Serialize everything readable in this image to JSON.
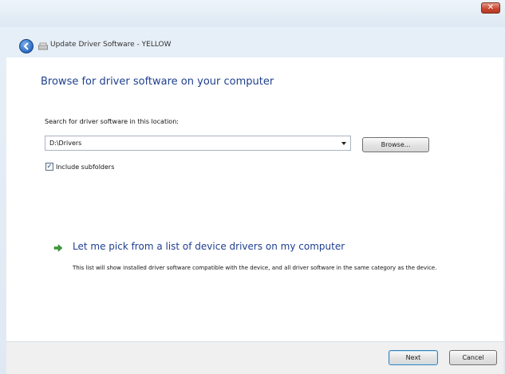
{
  "window": {
    "title": "Update Driver Software - YELLOW",
    "close_glyph": "✕"
  },
  "content": {
    "heading": "Browse for driver software on your computer",
    "search_label": "Search for driver software in this location:",
    "path_value": "D:\\Drivers",
    "browse_label": "Browse...",
    "include_subfolders_label": "Include subfolders",
    "include_subfolders_checked": true,
    "pick_link_title": "Let me pick from a list of device drivers on my computer",
    "pick_link_desc": "This list will show installed driver software compatible with the device, and all driver software in the same category as the device."
  },
  "footer": {
    "next_label": "Next",
    "cancel_label": "Cancel"
  },
  "colors": {
    "heading": "#1f3f8f",
    "link_arrow": "#3a9a3a",
    "close_button": "#c8452f"
  },
  "icons": {
    "back": "back-arrow-icon",
    "device": "device-icon",
    "link_arrow": "green-arrow-icon",
    "dropdown": "chevron-down-icon"
  }
}
